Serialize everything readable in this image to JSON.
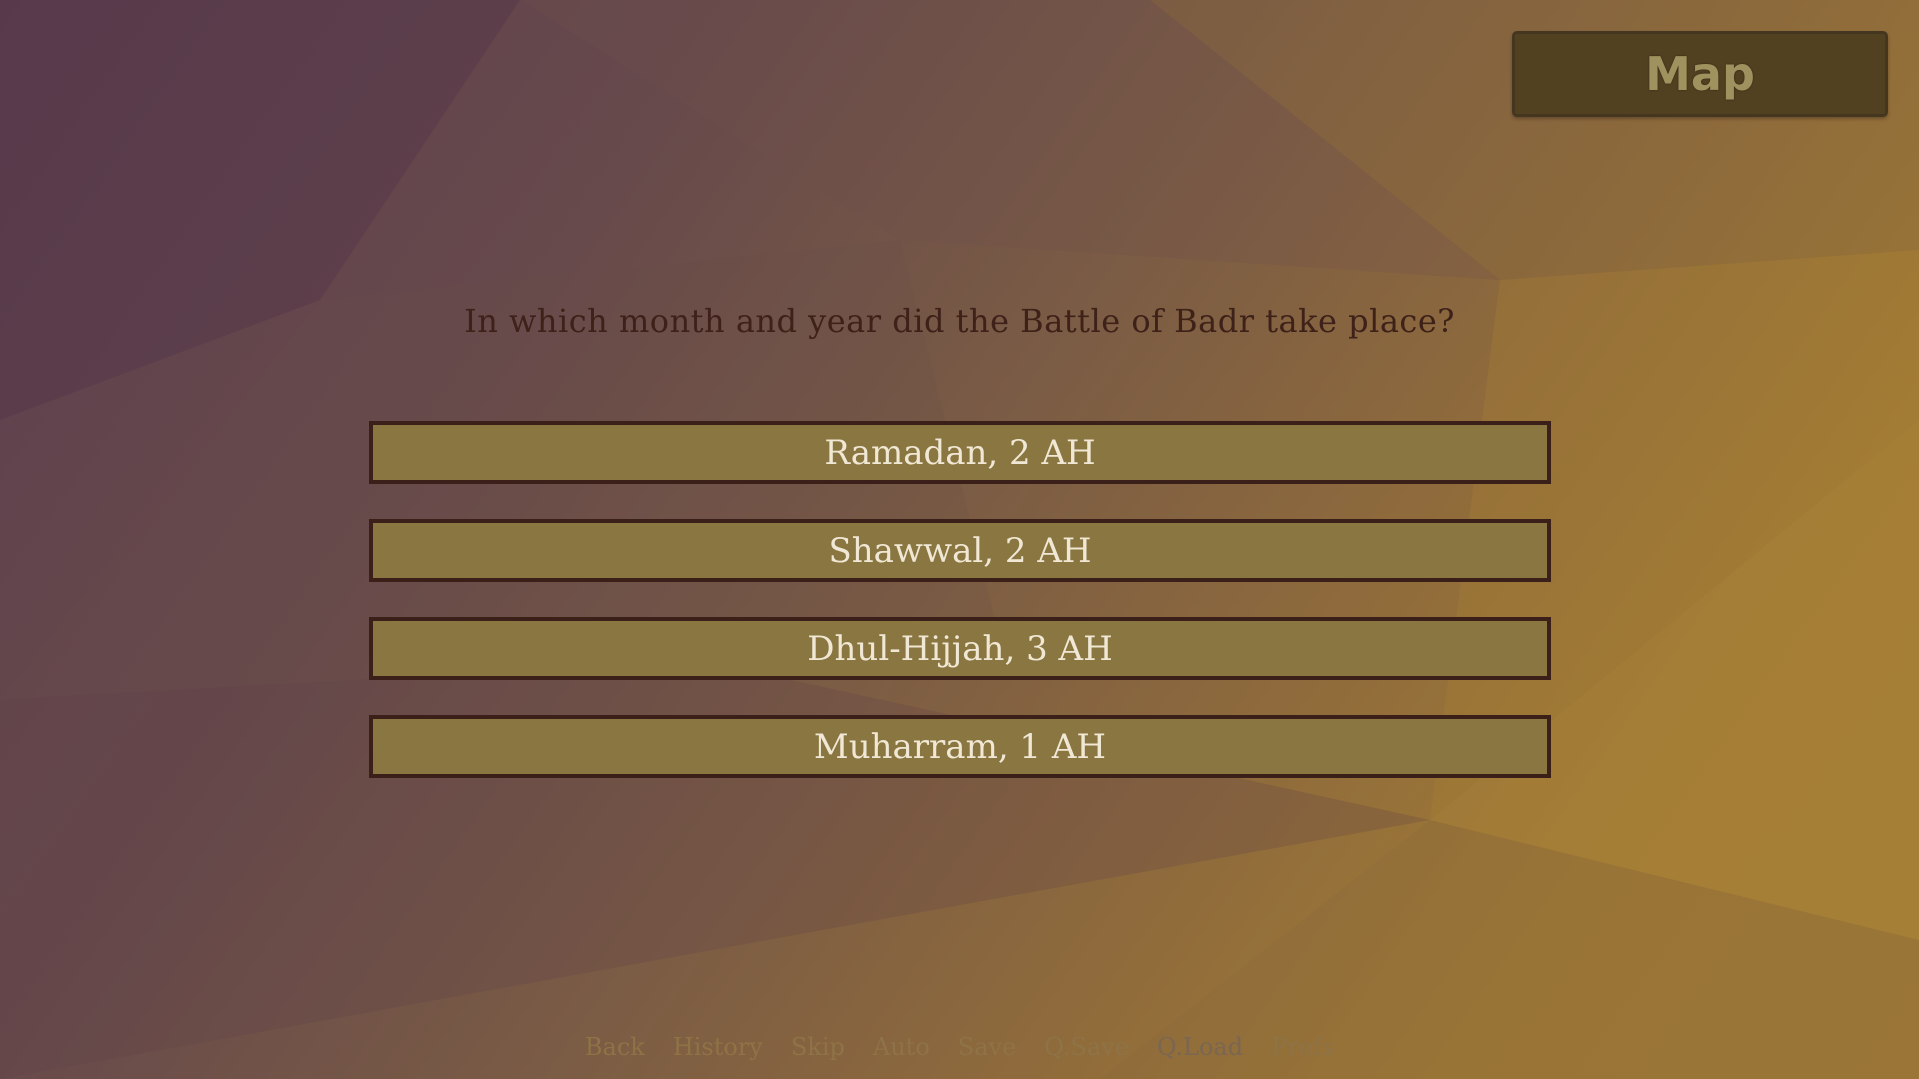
{
  "map_button": {
    "label": "Map"
  },
  "question": {
    "text": "In which month and year did the Battle of Badr take place?"
  },
  "choices": [
    {
      "label": "Ramadan, 2 AH"
    },
    {
      "label": "Shawwal, 2 AH"
    },
    {
      "label": "Dhul-Hijjah, 3 AH"
    },
    {
      "label": "Muharram, 1 AH"
    }
  ],
  "quick_menu": [
    {
      "label": "Back",
      "enabled": true
    },
    {
      "label": "History",
      "enabled": true
    },
    {
      "label": "Skip",
      "enabled": true
    },
    {
      "label": "Auto",
      "enabled": true
    },
    {
      "label": "Save",
      "enabled": true
    },
    {
      "label": "Q.Save",
      "enabled": true
    },
    {
      "label": "Q.Load",
      "enabled": false
    },
    {
      "label": "Prefs",
      "enabled": true
    }
  ],
  "colors": {
    "choice_fill": "#8a7641",
    "choice_border": "#3a2019",
    "choice_text": "#f0e8d4",
    "question_text": "#3e2118",
    "map_button_fill": "#524121",
    "map_button_text": "#9f925f",
    "quick_menu_text": "#8e7346"
  }
}
